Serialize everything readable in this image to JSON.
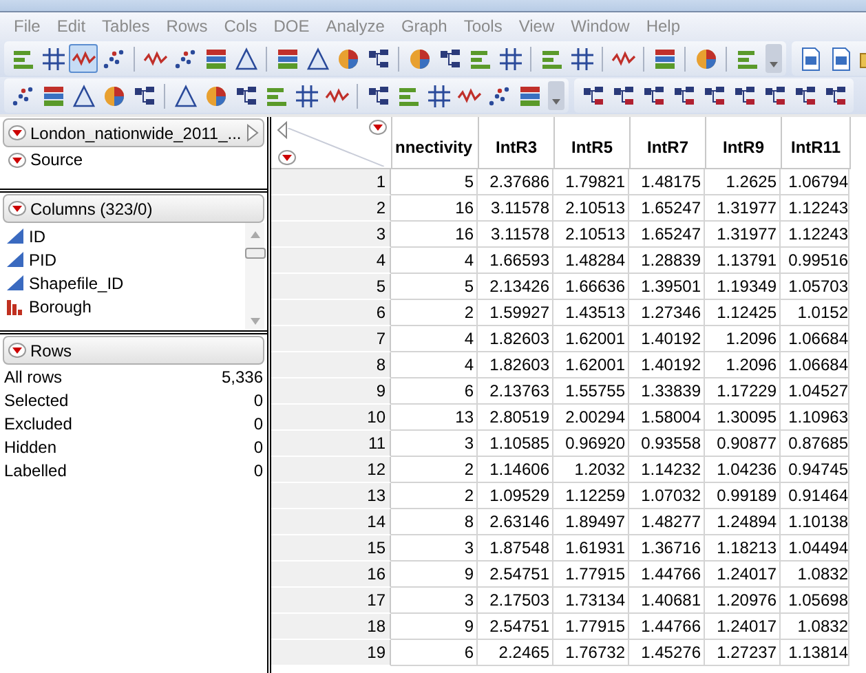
{
  "menu": [
    "File",
    "Edit",
    "Tables",
    "Rows",
    "Cols",
    "DOE",
    "Analyze",
    "Graph",
    "Tools",
    "View",
    "Window",
    "Help"
  ],
  "toolbars": [
    {
      "groups": [
        [
          {
            "selected": false
          },
          {
            "selected": false
          },
          {
            "selected": true
          },
          {
            "selected": false
          }
        ],
        [
          {
            "selected": false
          },
          {
            "selected": false
          },
          {
            "selected": false
          },
          {
            "selected": false
          }
        ],
        [
          {
            "selected": false
          },
          {
            "selected": false
          },
          {
            "selected": false
          },
          {
            "selected": false
          }
        ],
        [
          {
            "selected": false
          },
          {
            "selected": false
          },
          {
            "selected": false
          },
          {
            "selected": false
          }
        ],
        [
          {
            "selected": false
          },
          {
            "selected": false
          }
        ],
        [
          {
            "selected": false
          }
        ],
        [
          {
            "selected": false
          }
        ],
        [
          {
            "selected": false
          }
        ],
        [
          {
            "selected": false
          }
        ]
      ],
      "extra": [
        {
          "selected": false
        },
        {
          "selected": false
        },
        {
          "selected": false
        }
      ]
    },
    {
      "groups": [
        [
          {
            "selected": false
          },
          {
            "selected": false
          },
          {
            "selected": false
          },
          {
            "selected": false
          },
          {
            "selected": false
          }
        ],
        [
          {
            "selected": false
          },
          {
            "selected": false
          },
          {
            "selected": false
          },
          {
            "selected": false
          },
          {
            "selected": false
          },
          {
            "selected": false
          }
        ],
        [
          {
            "selected": false
          },
          {
            "selected": false
          },
          {
            "selected": false
          },
          {
            "selected": false
          },
          {
            "selected": false
          },
          {
            "selected": false
          }
        ]
      ],
      "extra": [
        {
          "selected": false
        },
        {
          "selected": false
        },
        {
          "selected": false
        },
        {
          "selected": false
        },
        {
          "selected": false
        },
        {
          "selected": false
        },
        {
          "selected": false
        },
        {
          "selected": false
        },
        {
          "selected": false
        }
      ]
    }
  ],
  "table_panel": {
    "title": "London_nationwide_2011_...",
    "scripts": [
      "Source"
    ]
  },
  "columns_panel": {
    "title": "Columns (323/0)",
    "items": [
      {
        "name": "ID",
        "kind": "continuous"
      },
      {
        "name": "PID",
        "kind": "continuous"
      },
      {
        "name": "Shapefile_ID",
        "kind": "continuous"
      },
      {
        "name": "Borough",
        "kind": "nominal"
      }
    ]
  },
  "rows_panel": {
    "title": "Rows",
    "items": [
      {
        "label": "All rows",
        "value": "5,336"
      },
      {
        "label": "Selected",
        "value": "0"
      },
      {
        "label": "Excluded",
        "value": "0"
      },
      {
        "label": "Hidden",
        "value": "0"
      },
      {
        "label": "Labelled",
        "value": "0"
      }
    ]
  },
  "table": {
    "columns": [
      "nnectivity",
      "IntR3",
      "IntR5",
      "IntR7",
      "IntR9",
      "IntR11"
    ],
    "rows": [
      {
        "number": "1",
        "cells": [
          "5",
          "2.37686",
          "1.79821",
          "1.48175",
          "1.2625",
          "1.06794"
        ]
      },
      {
        "number": "2",
        "cells": [
          "16",
          "3.11578",
          "2.10513",
          "1.65247",
          "1.31977",
          "1.12243"
        ]
      },
      {
        "number": "3",
        "cells": [
          "16",
          "3.11578",
          "2.10513",
          "1.65247",
          "1.31977",
          "1.12243"
        ]
      },
      {
        "number": "4",
        "cells": [
          "4",
          "1.66593",
          "1.48284",
          "1.28839",
          "1.13791",
          "0.99516"
        ]
      },
      {
        "number": "5",
        "cells": [
          "5",
          "2.13426",
          "1.66636",
          "1.39501",
          "1.19349",
          "1.05703"
        ]
      },
      {
        "number": "6",
        "cells": [
          "2",
          "1.59927",
          "1.43513",
          "1.27346",
          "1.12425",
          "1.0152"
        ]
      },
      {
        "number": "7",
        "cells": [
          "4",
          "1.82603",
          "1.62001",
          "1.40192",
          "1.2096",
          "1.06684"
        ]
      },
      {
        "number": "8",
        "cells": [
          "4",
          "1.82603",
          "1.62001",
          "1.40192",
          "1.2096",
          "1.06684"
        ]
      },
      {
        "number": "9",
        "cells": [
          "6",
          "2.13763",
          "1.55755",
          "1.33839",
          "1.17229",
          "1.04527"
        ]
      },
      {
        "number": "10",
        "cells": [
          "13",
          "2.80519",
          "2.00294",
          "1.58004",
          "1.30095",
          "1.10963"
        ]
      },
      {
        "number": "11",
        "cells": [
          "3",
          "1.10585",
          "0.96920",
          "0.93558",
          "0.90877",
          "0.87685"
        ]
      },
      {
        "number": "12",
        "cells": [
          "2",
          "1.14606",
          "1.2032",
          "1.14232",
          "1.04236",
          "0.94745"
        ]
      },
      {
        "number": "13",
        "cells": [
          "2",
          "1.09529",
          "1.12259",
          "1.07032",
          "0.99189",
          "0.91464"
        ]
      },
      {
        "number": "14",
        "cells": [
          "8",
          "2.63146",
          "1.89497",
          "1.48277",
          "1.24894",
          "1.10138"
        ]
      },
      {
        "number": "15",
        "cells": [
          "3",
          "1.87548",
          "1.61931",
          "1.36716",
          "1.18213",
          "1.04494"
        ]
      },
      {
        "number": "16",
        "cells": [
          "9",
          "2.54751",
          "1.77915",
          "1.44766",
          "1.24017",
          "1.0832"
        ]
      },
      {
        "number": "17",
        "cells": [
          "3",
          "2.17503",
          "1.73134",
          "1.40681",
          "1.20976",
          "1.05698"
        ]
      },
      {
        "number": "18",
        "cells": [
          "9",
          "2.54751",
          "1.77915",
          "1.44766",
          "1.24017",
          "1.0832"
        ]
      },
      {
        "number": "19",
        "cells": [
          "6",
          "2.2465",
          "1.76732",
          "1.45276",
          "1.27237",
          "1.13814"
        ]
      }
    ]
  }
}
